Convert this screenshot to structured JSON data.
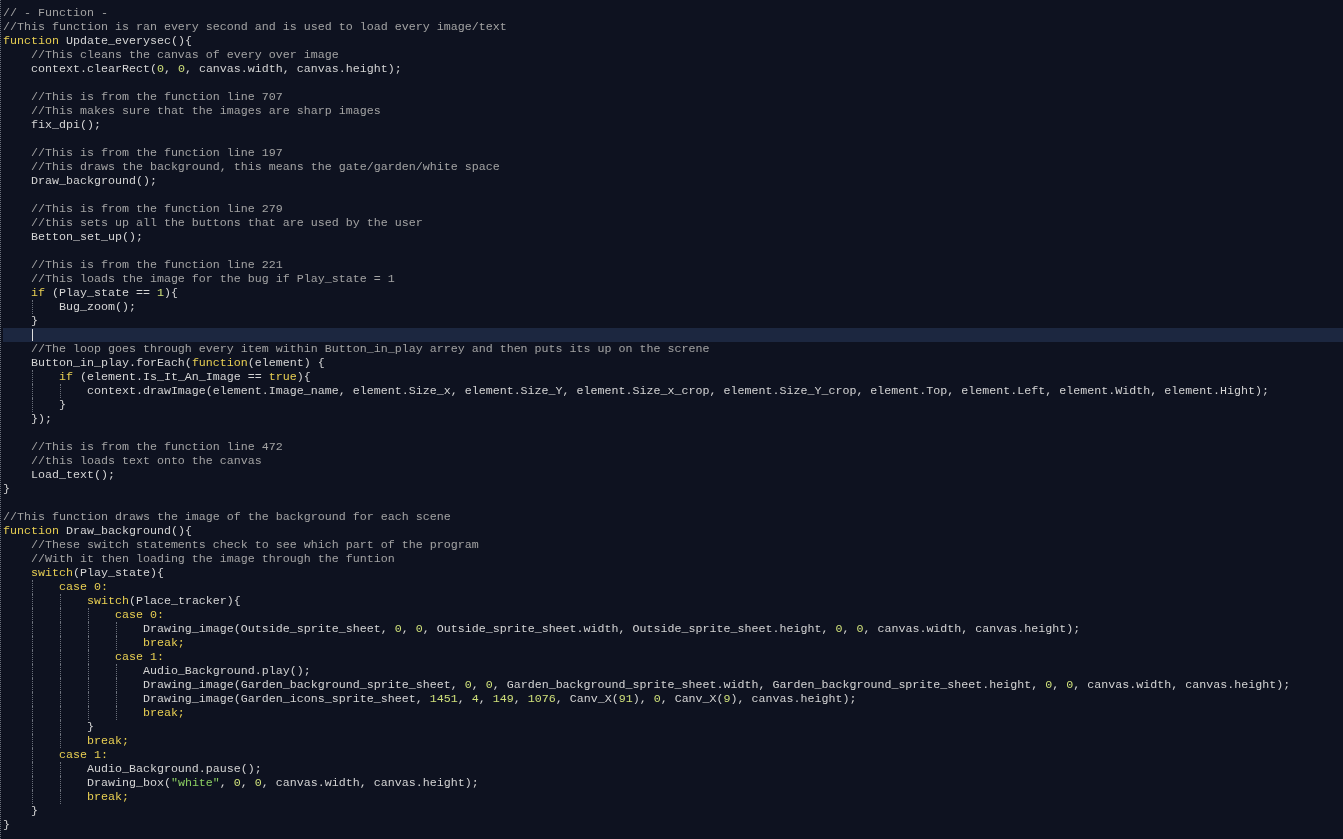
{
  "editor": {
    "lines": [
      {
        "current": false,
        "tokens": [
          {
            "kind": "comment",
            "text": "// - Function -"
          }
        ]
      },
      {
        "current": false,
        "tokens": [
          {
            "kind": "comment",
            "text": "//This function is ran every second and is used to load every image/text"
          }
        ]
      },
      {
        "current": false,
        "tokens": [
          {
            "kind": "keyword",
            "text": "function"
          },
          {
            "kind": "plain",
            "text": " Update_everysec(){"
          }
        ]
      },
      {
        "current": false,
        "tokens": [
          {
            "kind": "comment",
            "text": "    //This cleans the canvas of every over image"
          }
        ]
      },
      {
        "current": false,
        "tokens": [
          {
            "kind": "plain",
            "text": "    context.clearRect("
          },
          {
            "kind": "number",
            "text": "0"
          },
          {
            "kind": "plain",
            "text": ", "
          },
          {
            "kind": "number",
            "text": "0"
          },
          {
            "kind": "plain",
            "text": ", canvas.width, canvas.height);"
          }
        ]
      },
      {
        "current": false
      },
      {
        "current": false,
        "tokens": [
          {
            "kind": "comment",
            "text": "    //This is from the function line 707"
          }
        ]
      },
      {
        "current": false,
        "tokens": [
          {
            "kind": "comment",
            "text": "    //This makes sure that the images are sharp images"
          }
        ]
      },
      {
        "current": false,
        "tokens": [
          {
            "kind": "plain",
            "text": "    fix_dpi();"
          }
        ]
      },
      {
        "current": false
      },
      {
        "current": false,
        "tokens": [
          {
            "kind": "comment",
            "text": "    //This is from the function line 197"
          }
        ]
      },
      {
        "current": false,
        "tokens": [
          {
            "kind": "comment",
            "text": "    //This draws the background, this means the gate/garden/white space"
          }
        ]
      },
      {
        "current": false,
        "tokens": [
          {
            "kind": "plain",
            "text": "    Draw_background();"
          }
        ]
      },
      {
        "current": false
      },
      {
        "current": false,
        "tokens": [
          {
            "kind": "comment",
            "text": "    //This is from the function line 279"
          }
        ]
      },
      {
        "current": false,
        "tokens": [
          {
            "kind": "comment",
            "text": "    //this sets up all the buttons that are used by the user"
          }
        ]
      },
      {
        "current": false,
        "tokens": [
          {
            "kind": "plain",
            "text": "    Betton_set_up();"
          }
        ]
      },
      {
        "current": false
      },
      {
        "current": false,
        "tokens": [
          {
            "kind": "comment",
            "text": "    //This is from the function line 221"
          }
        ]
      },
      {
        "current": false,
        "tokens": [
          {
            "kind": "comment",
            "text": "    //This loads the image for the bug if Play_state = 1"
          }
        ]
      },
      {
        "current": false,
        "tokens": [
          {
            "kind": "keyword",
            "text": "    if"
          },
          {
            "kind": "plain",
            "text": " (Play_state == "
          },
          {
            "kind": "number",
            "text": "1"
          },
          {
            "kind": "plain",
            "text": "){"
          }
        ]
      },
      {
        "current": false,
        "tokens": [
          {
            "kind": "plain",
            "text": "        Bug_zoom();"
          }
        ]
      },
      {
        "current": false,
        "tokens": [
          {
            "kind": "plain",
            "text": "    }"
          }
        ]
      },
      {
        "current": true
      },
      {
        "current": false,
        "tokens": [
          {
            "kind": "comment",
            "text": "    //The loop goes through every item within Button_in_play arrey and then puts its up on the screne"
          }
        ]
      },
      {
        "current": false,
        "tokens": [
          {
            "kind": "plain",
            "text": "    Button_in_play.forEach("
          },
          {
            "kind": "keyword",
            "text": "function"
          },
          {
            "kind": "plain",
            "text": "(element) {"
          }
        ]
      },
      {
        "current": false,
        "tokens": [
          {
            "kind": "keyword",
            "text": "        if"
          },
          {
            "kind": "plain",
            "text": " (element.Is_It_An_Image == "
          },
          {
            "kind": "keyword",
            "text": "true"
          },
          {
            "kind": "plain",
            "text": "){"
          }
        ]
      },
      {
        "current": false,
        "tokens": [
          {
            "kind": "plain",
            "text": "            context.drawImage(element.Image_name, element.Size_x, element.Size_Y, element.Size_x_crop, element.Size_Y_crop, element.Top, element.Left, element.Width, element.Hight);"
          }
        ]
      },
      {
        "current": false,
        "tokens": [
          {
            "kind": "plain",
            "text": "        }"
          }
        ]
      },
      {
        "current": false,
        "tokens": [
          {
            "kind": "plain",
            "text": "    });"
          }
        ]
      },
      {
        "current": false
      },
      {
        "current": false,
        "tokens": [
          {
            "kind": "comment",
            "text": "    //This is from the function line 472"
          }
        ]
      },
      {
        "current": false,
        "tokens": [
          {
            "kind": "comment",
            "text": "    //this loads text onto the canvas"
          }
        ]
      },
      {
        "current": false,
        "tokens": [
          {
            "kind": "plain",
            "text": "    Load_text();"
          }
        ]
      },
      {
        "current": false,
        "tokens": [
          {
            "kind": "plain",
            "text": "}"
          }
        ]
      },
      {
        "current": false
      },
      {
        "current": false,
        "tokens": [
          {
            "kind": "comment",
            "text": "//This function draws the image of the background for each scene"
          }
        ]
      },
      {
        "current": false,
        "tokens": [
          {
            "kind": "keyword",
            "text": "function"
          },
          {
            "kind": "plain",
            "text": " Draw_background(){"
          }
        ]
      },
      {
        "current": false,
        "tokens": [
          {
            "kind": "comment",
            "text": "    //These switch statements check to see which part of the program"
          }
        ]
      },
      {
        "current": false,
        "tokens": [
          {
            "kind": "comment",
            "text": "    //With it then loading the image through the funtion"
          }
        ]
      },
      {
        "current": false,
        "tokens": [
          {
            "kind": "keyword",
            "text": "    switch"
          },
          {
            "kind": "plain",
            "text": "(Play_state){"
          }
        ]
      },
      {
        "current": false,
        "tokens": [
          {
            "kind": "keyword",
            "text": "        case 0:"
          }
        ]
      },
      {
        "current": false,
        "tokens": [
          {
            "kind": "keyword",
            "text": "            switch"
          },
          {
            "kind": "plain",
            "text": "(Place_tracker){"
          }
        ]
      },
      {
        "current": false,
        "tokens": [
          {
            "kind": "keyword",
            "text": "                case 0:"
          }
        ]
      },
      {
        "current": false,
        "tokens": [
          {
            "kind": "plain",
            "text": "                    Drawing_image(Outside_sprite_sheet, "
          },
          {
            "kind": "number",
            "text": "0"
          },
          {
            "kind": "plain",
            "text": ", "
          },
          {
            "kind": "number",
            "text": "0"
          },
          {
            "kind": "plain",
            "text": ", Outside_sprite_sheet.width, Outside_sprite_sheet.height, "
          },
          {
            "kind": "number",
            "text": "0"
          },
          {
            "kind": "plain",
            "text": ", "
          },
          {
            "kind": "number",
            "text": "0"
          },
          {
            "kind": "plain",
            "text": ", canvas.width, canvas.height);"
          }
        ]
      },
      {
        "current": false,
        "tokens": [
          {
            "kind": "keyword",
            "text": "                    break;"
          }
        ]
      },
      {
        "current": false,
        "tokens": [
          {
            "kind": "keyword",
            "text": "                case 1:"
          }
        ]
      },
      {
        "current": false,
        "tokens": [
          {
            "kind": "plain",
            "text": "                    Audio_Background.play();"
          }
        ]
      },
      {
        "current": false,
        "tokens": [
          {
            "kind": "plain",
            "text": "                    Drawing_image(Garden_background_sprite_sheet, "
          },
          {
            "kind": "number",
            "text": "0"
          },
          {
            "kind": "plain",
            "text": ", "
          },
          {
            "kind": "number",
            "text": "0"
          },
          {
            "kind": "plain",
            "text": ", Garden_background_sprite_sheet.width, Garden_background_sprite_sheet.height, "
          },
          {
            "kind": "number",
            "text": "0"
          },
          {
            "kind": "plain",
            "text": ", "
          },
          {
            "kind": "number",
            "text": "0"
          },
          {
            "kind": "plain",
            "text": ", canvas.width, canvas.height);"
          }
        ]
      },
      {
        "current": false,
        "tokens": [
          {
            "kind": "plain",
            "text": "                    Drawing_image(Garden_icons_sprite_sheet, "
          },
          {
            "kind": "number",
            "text": "1451"
          },
          {
            "kind": "plain",
            "text": ", "
          },
          {
            "kind": "number",
            "text": "4"
          },
          {
            "kind": "plain",
            "text": ", "
          },
          {
            "kind": "number",
            "text": "149"
          },
          {
            "kind": "plain",
            "text": ", "
          },
          {
            "kind": "number",
            "text": "1076"
          },
          {
            "kind": "plain",
            "text": ", Canv_X("
          },
          {
            "kind": "number",
            "text": "91"
          },
          {
            "kind": "plain",
            "text": "), "
          },
          {
            "kind": "number",
            "text": "0"
          },
          {
            "kind": "plain",
            "text": ", Canv_X("
          },
          {
            "kind": "number",
            "text": "9"
          },
          {
            "kind": "plain",
            "text": "), canvas.height);"
          }
        ]
      },
      {
        "current": false,
        "tokens": [
          {
            "kind": "keyword",
            "text": "                    break;"
          }
        ]
      },
      {
        "current": false,
        "tokens": [
          {
            "kind": "plain",
            "text": "            }"
          }
        ]
      },
      {
        "current": false,
        "tokens": [
          {
            "kind": "keyword",
            "text": "            break;"
          }
        ]
      },
      {
        "current": false,
        "tokens": [
          {
            "kind": "keyword",
            "text": "        case 1:"
          }
        ]
      },
      {
        "current": false,
        "tokens": [
          {
            "kind": "plain",
            "text": "            Audio_Background.pause();"
          }
        ]
      },
      {
        "current": false,
        "tokens": [
          {
            "kind": "plain",
            "text": "            Drawing_box("
          },
          {
            "kind": "string",
            "text": "\"white\""
          },
          {
            "kind": "plain",
            "text": ", "
          },
          {
            "kind": "number",
            "text": "0"
          },
          {
            "kind": "plain",
            "text": ", "
          },
          {
            "kind": "number",
            "text": "0"
          },
          {
            "kind": "plain",
            "text": ", canvas.width, canvas.height);"
          }
        ]
      },
      {
        "current": false,
        "tokens": [
          {
            "kind": "keyword",
            "text": "            break;"
          }
        ]
      },
      {
        "current": false,
        "tokens": [
          {
            "kind": "plain",
            "text": "    }"
          }
        ]
      },
      {
        "current": false,
        "tokens": [
          {
            "kind": "plain",
            "text": "}"
          }
        ]
      }
    ]
  }
}
